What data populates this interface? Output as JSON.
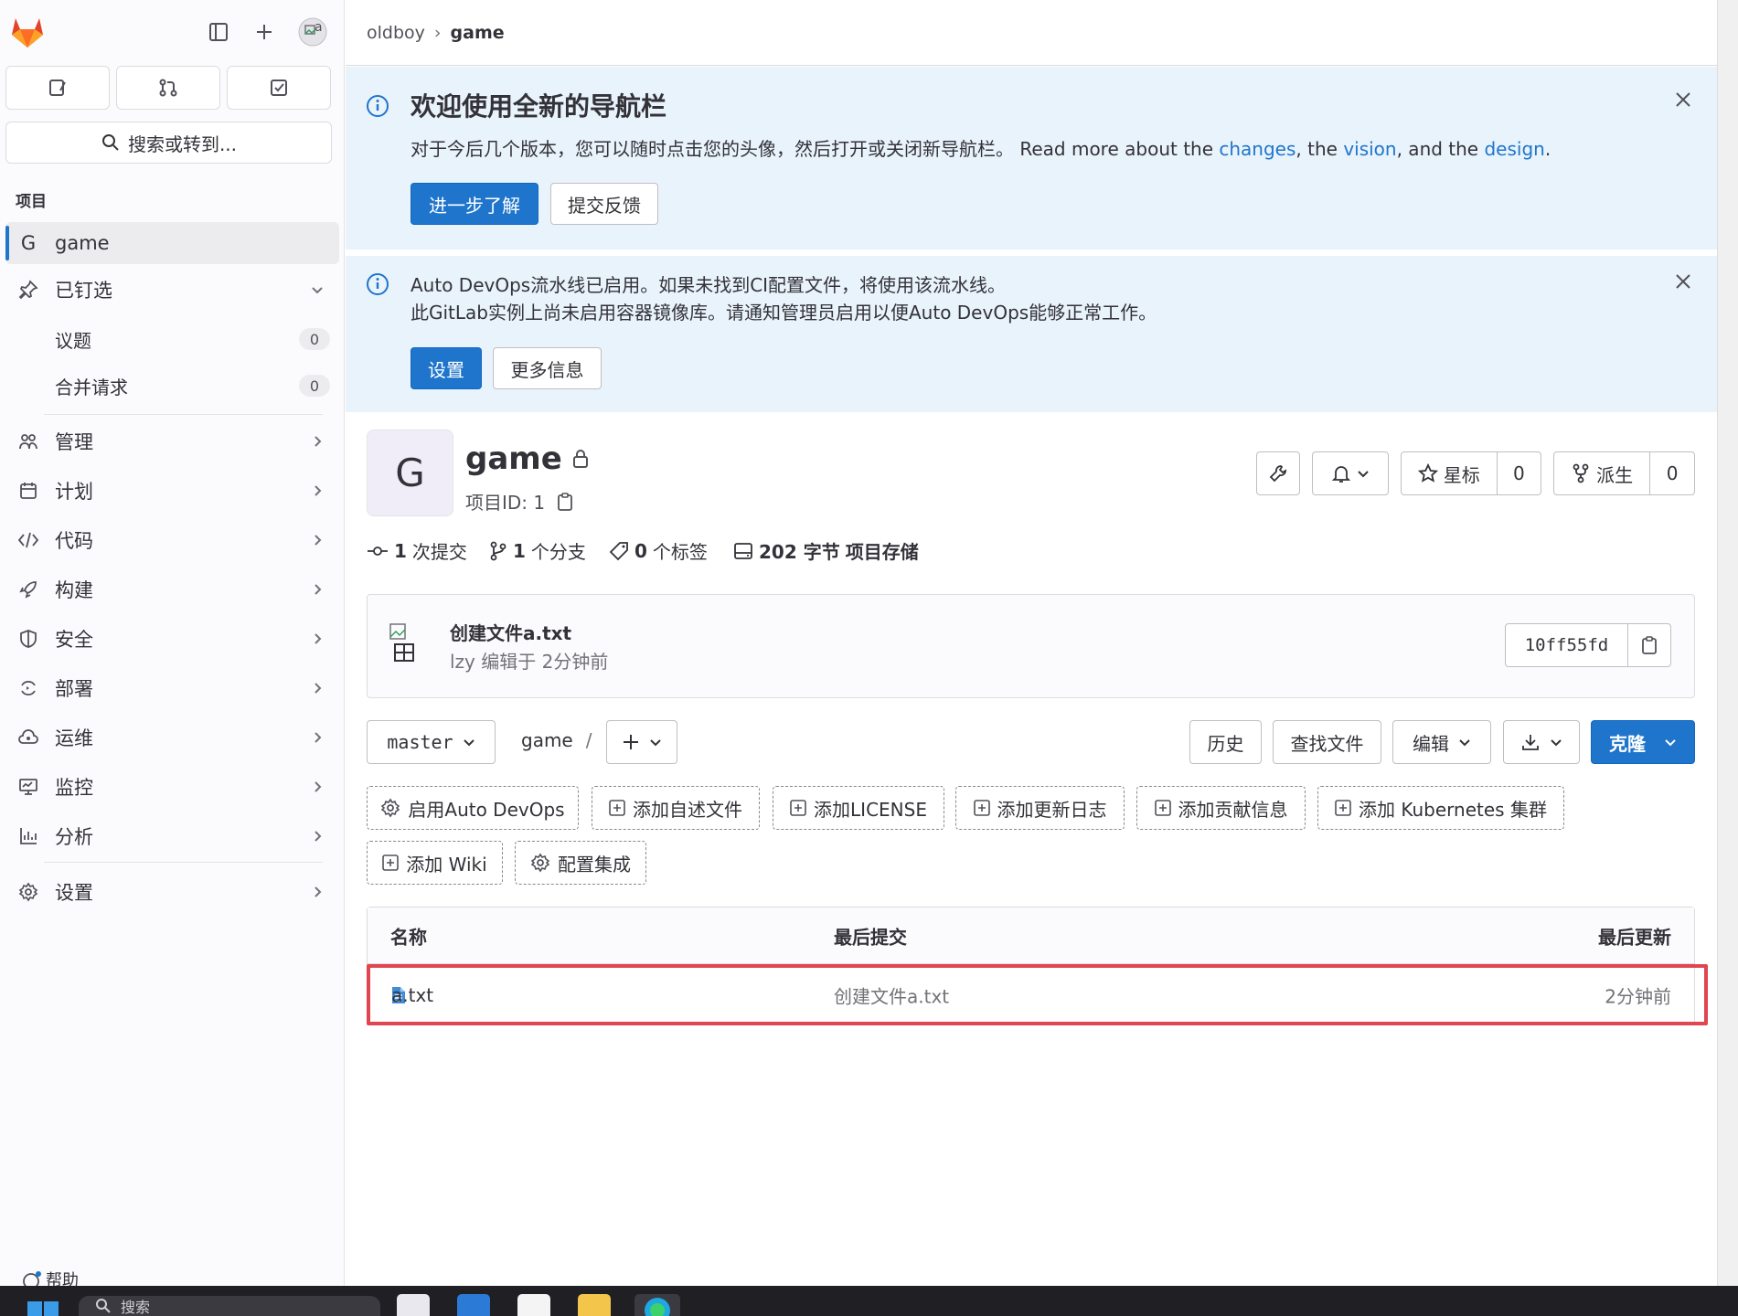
{
  "sidebar": {
    "search_label": "搜索或转到...",
    "section_title": "项目",
    "project_item": {
      "initial": "G",
      "label": "game"
    },
    "pinned": {
      "label": "已钉选",
      "items": [
        {
          "label": "议题",
          "count": "0"
        },
        {
          "label": "合并请求",
          "count": "0"
        }
      ]
    },
    "menu": [
      {
        "label": "管理",
        "icon": "users-icon"
      },
      {
        "label": "计划",
        "icon": "calendar-icon"
      },
      {
        "label": "代码",
        "icon": "code-icon"
      },
      {
        "label": "构建",
        "icon": "rocket-icon"
      },
      {
        "label": "安全",
        "icon": "shield-icon"
      },
      {
        "label": "部署",
        "icon": "deployments-icon"
      },
      {
        "label": "运维",
        "icon": "cloud-gear-icon"
      },
      {
        "label": "监控",
        "icon": "monitor-icon"
      },
      {
        "label": "分析",
        "icon": "chart-icon"
      }
    ],
    "settings_label": "设置",
    "help_label": "帮助",
    "avatar_alt": "a"
  },
  "breadcrumb": {
    "parent": "oldboy",
    "current": "game",
    "sep": "›"
  },
  "banner1": {
    "title": "欢迎使用全新的导航栏",
    "text_prefix": "对于今后几个版本，您可以随时点击您的头像，然后打开或关闭新导航栏。 Read more about the ",
    "link1": "changes",
    "mid1": ", the ",
    "link2": "vision",
    "mid2": ", and the ",
    "link3": "design",
    "suffix": ".",
    "primary_button": "进一步了解",
    "secondary_button": "提交反馈"
  },
  "banner2": {
    "line1": "Auto DevOps流水线已启用。如果未找到CI配置文件，将使用该流水线。",
    "line2": "此GitLab实例上尚未启用容器镜像库。请通知管理员启用以便Auto DevOps能够正常工作。",
    "primary_button": "设置",
    "secondary_button": "更多信息"
  },
  "project": {
    "initial": "G",
    "name": "game",
    "id_label": "项目ID: 1",
    "star_label": "星标",
    "star_count": "0",
    "fork_label": "派生",
    "fork_count": "0"
  },
  "stats": [
    {
      "value": "1",
      "label": "次提交"
    },
    {
      "value": "1",
      "label": "个分支"
    },
    {
      "value": "0",
      "label": "个标签"
    },
    {
      "value": "202 字节",
      "label": "项目存储"
    }
  ],
  "commit": {
    "title": "创建文件a.txt",
    "meta": "lzy 编辑于 2分钟前",
    "sha": "10ff55fd",
    "avatar_alt": "田"
  },
  "toolbar": {
    "branch": "master",
    "path": "game",
    "path_sep": "/",
    "history": "历史",
    "find_file": "查找文件",
    "edit": "编辑",
    "clone": "克隆"
  },
  "suggestions": [
    "启用Auto DevOps",
    "添加自述文件",
    "添加LICENSE",
    "添加更新日志",
    "添加贡献信息",
    "添加 Kubernetes 集群",
    "添加 Wiki",
    "配置集成"
  ],
  "table": {
    "headers": [
      "名称",
      "最后提交",
      "最后更新"
    ],
    "rows": [
      {
        "name": "a.txt",
        "commit": "创建文件a.txt",
        "updated": "2分钟前"
      }
    ]
  },
  "taskbar": {
    "search_label": "搜索"
  },
  "colors": {
    "accent": "#1f75cb",
    "banner_bg": "#e9f3fc",
    "highlight": "#e0464f"
  }
}
